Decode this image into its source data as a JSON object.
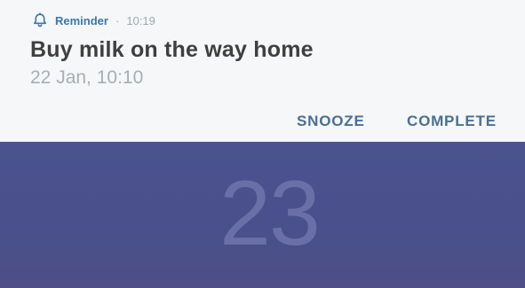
{
  "notification": {
    "app_icon": "reminder-bell-icon",
    "app_name": "Reminder",
    "separator": "·",
    "time": "10:19",
    "title": "Buy milk on the way home",
    "subtitle": "22 Jan, 10:10",
    "actions": {
      "snooze": "SNOOZE",
      "complete": "COMPLETE"
    }
  },
  "lockscreen": {
    "date_number": "23"
  },
  "colors": {
    "notification_bg": "#f5f7f8",
    "accent": "#3d78a8",
    "action_text": "#4a6f95",
    "lockscreen_bg": "#4b5087"
  }
}
